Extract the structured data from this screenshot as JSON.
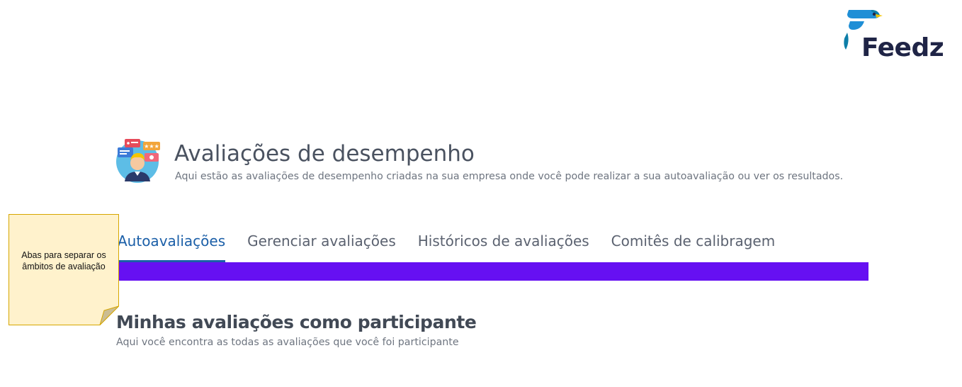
{
  "brand": {
    "name": "Feedz",
    "colors": {
      "wordmark": "#1f2446",
      "blue": "#1f8fd6",
      "yellow": "#f5c400",
      "teal": "#0d7ea8"
    }
  },
  "header": {
    "title": "Avaliações de desempenho",
    "subtitle": "Aqui estão as avaliações de desempenho criadas na sua empresa onde você pode realizar a sua autoavaliação ou ver os resultados."
  },
  "tabs": [
    {
      "label": "Autoavaliações",
      "active": true
    },
    {
      "label": "Gerenciar avaliações",
      "active": false
    },
    {
      "label": "Históricos de avaliações",
      "active": false
    },
    {
      "label": "Comitês de calibragem",
      "active": false
    }
  ],
  "colors": {
    "accent_band": "#6610f2",
    "active_tab": "#1b5fa8",
    "note_fill": "#fff2cc",
    "note_border": "#d6a600"
  },
  "section": {
    "title": "Minhas avaliações como participante",
    "subtitle": "Aqui você encontra as todas as avaliações que você foi participante"
  },
  "annotation": {
    "text": "Abas para separar os âmbitos de avaliação"
  },
  "icons": {
    "logo": "feedz-bird-logo",
    "hero": "performance-review-illustration"
  }
}
